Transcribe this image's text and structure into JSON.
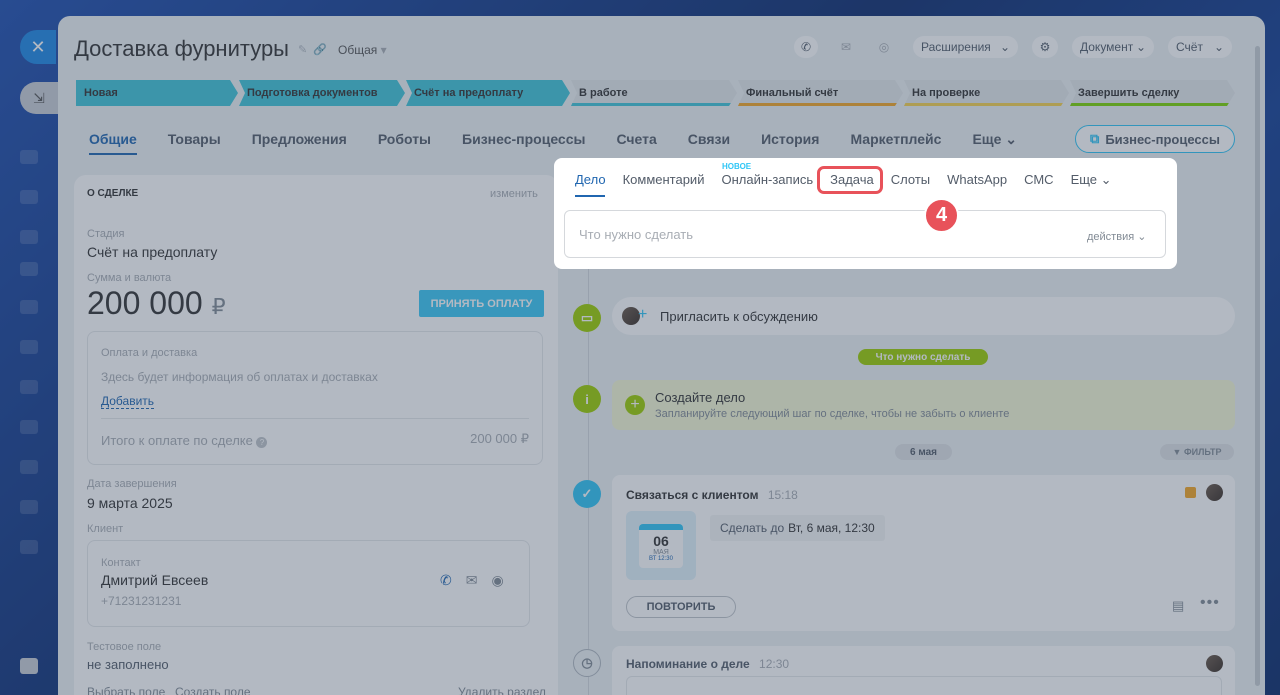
{
  "deal": {
    "title": "Доставка фурнитуры",
    "category": "Общая"
  },
  "toolbar": {
    "extensions": "Расширения",
    "document": "Документ",
    "invoice": "Счёт"
  },
  "stages": [
    {
      "label": "Новая",
      "done": true,
      "color": "#3fc6d8"
    },
    {
      "label": "Подготовка документов",
      "done": true,
      "color": "#3fc6d8"
    },
    {
      "label": "Счёт на предоплату",
      "done": true,
      "color": "#3fc6d8"
    },
    {
      "label": "В работе",
      "done": false,
      "color": "#3fc6d8"
    },
    {
      "label": "Финальный счёт",
      "done": false,
      "color": "#f5a623"
    },
    {
      "label": "На проверке",
      "done": false,
      "color": "#f7d24c"
    },
    {
      "label": "Завершить сделку",
      "done": false,
      "color": "#7bd500"
    }
  ],
  "tabs": [
    "Общие",
    "Товары",
    "Предложения",
    "Роботы",
    "Бизнес-процессы",
    "Счета",
    "Связи",
    "История",
    "Маркетплейс",
    "Еще"
  ],
  "bp_button": "Бизнес-процессы",
  "about": {
    "header": "О СДЕЛКЕ",
    "edit": "изменить",
    "stage_label": "Стадия",
    "stage_value": "Счёт на предоплату",
    "sum_label": "Сумма и валюта",
    "sum": "200 000",
    "currency": "₽",
    "pay_button": "ПРИНЯТЬ ОПЛАТУ",
    "payment_title": "Оплата и доставка",
    "payment_hint": "Здесь будет информация об оплатах и доставках",
    "payment_add": "Добавить",
    "total_label": "Итого к оплате по сделке",
    "total_value": "200 000 ₽",
    "close_label": "Дата завершения",
    "close_value": "9 марта 2025",
    "client_label": "Клиент",
    "contact_label": "Контакт",
    "contact_name": "Дмитрий Евсеев",
    "contact_phone": "+71231231231",
    "test_label": "Тестовое поле",
    "test_value": "не заполнено",
    "select_field": "Выбрать поле",
    "create_field": "Создать поле",
    "delete_section": "Удалить раздел"
  },
  "composer": {
    "tabs": [
      "Дело",
      "Комментарий",
      "Онлайн-запись",
      "Задача",
      "Слоты",
      "WhatsApp",
      "СМС",
      "Еще"
    ],
    "new_badge": "НОВОЕ",
    "placeholder": "Что нужно сделать",
    "actions": "действия"
  },
  "step_number": "4",
  "invite": "Пригласить к обсуждению",
  "todo_pill": "Что нужно сделать",
  "create_task": {
    "title": "Создайте дело",
    "subtitle": "Запланируйте следующий шаг по сделке, чтобы не забыть о клиенте"
  },
  "date_pill": "6 мая",
  "filter": "ФИЛЬТР",
  "task": {
    "title": "Связаться с клиентом",
    "time": "15:18",
    "day": "06",
    "month": "МАЯ",
    "cal_time": "ВТ 12:30",
    "deadline_prefix": "Сделать до",
    "deadline": "Вт, 6 мая, 12:30",
    "repeat": "ПОВТОРИТЬ"
  },
  "reminder": {
    "title": "Напоминание о деле",
    "time": "12:30"
  }
}
